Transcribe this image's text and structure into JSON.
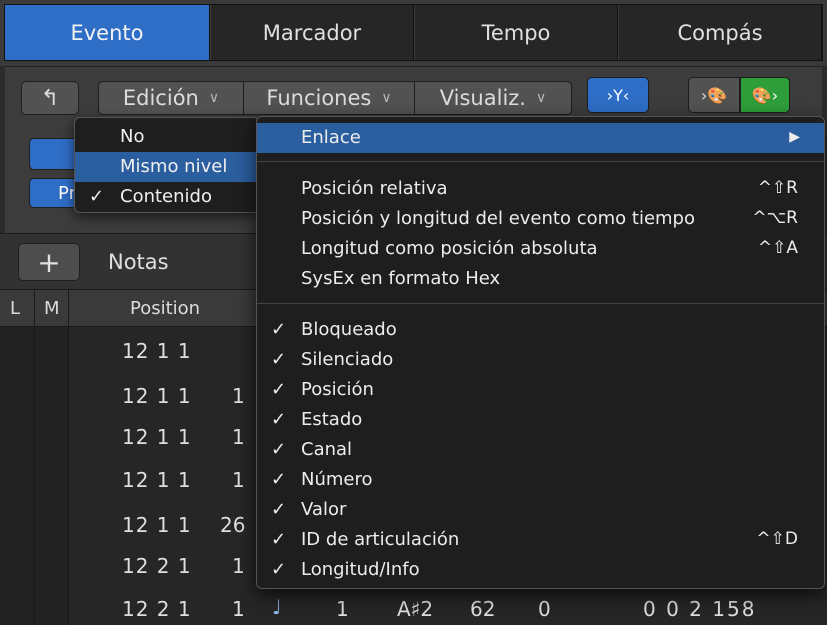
{
  "tabs": [
    "Evento",
    "Marcador",
    "Tempo",
    "Compás"
  ],
  "toolbar": {
    "back_glyph": "↰",
    "edicion": "Edición",
    "funciones": "Funciones",
    "visualiz": "Visualiz.",
    "filter_glyph": "›Y‹",
    "out_glyph": "›🎨",
    "in_glyph": "🎨›",
    "row2_b_text": "Pr"
  },
  "list": {
    "add_glyph": "+",
    "title": "Notas",
    "columns": {
      "l": "L",
      "m": "M",
      "position": "Position"
    }
  },
  "rows": [
    {
      "pos": "12 1 1",
      "frac": ""
    },
    {
      "pos": "12 1 1",
      "frac": "1"
    },
    {
      "pos": "12 1 1",
      "frac": "1"
    },
    {
      "pos": "12 1 1",
      "frac": "1"
    },
    {
      "pos": "12 1 1",
      "frac": "26"
    },
    {
      "pos": "12 2 1",
      "frac": "1"
    }
  ],
  "last_row": {
    "pos": "12 2 1",
    "frac": "1",
    "note_glyph": "♩",
    "channel": "1",
    "number": "A♯2",
    "value": "62",
    "articulation": "0",
    "length": "0 0 2 158"
  },
  "submenu": {
    "items": [
      {
        "label": "No",
        "checked": false,
        "highlighted": false
      },
      {
        "label": "Mismo nivel",
        "checked": false,
        "highlighted": true
      },
      {
        "label": "Contenido",
        "checked": true,
        "highlighted": false
      }
    ]
  },
  "mainmenu": {
    "enlace": "Enlace",
    "section1": [
      {
        "label": "Posición relativa",
        "shortcut": "^⇧R"
      },
      {
        "label": "Posición y longitud del evento como tiempo",
        "shortcut": "^⌥R"
      },
      {
        "label": "Longitud como posición absoluta",
        "shortcut": "^⇧A"
      },
      {
        "label": "SysEx en formato Hex",
        "shortcut": ""
      }
    ],
    "section2": [
      {
        "label": "Bloqueado",
        "shortcut": ""
      },
      {
        "label": "Silenciado",
        "shortcut": ""
      },
      {
        "label": "Posición",
        "shortcut": ""
      },
      {
        "label": "Estado",
        "shortcut": ""
      },
      {
        "label": "Canal",
        "shortcut": ""
      },
      {
        "label": "Número",
        "shortcut": ""
      },
      {
        "label": "Valor",
        "shortcut": ""
      },
      {
        "label": "ID de articulación",
        "shortcut": "^⇧D"
      },
      {
        "label": "Longitud/Info",
        "shortcut": ""
      }
    ],
    "check_glyph": "✓",
    "arrow_glyph": "▶"
  },
  "colors": {
    "accent": "#2f6ec7",
    "highlight": "#2b5e9f",
    "green": "#2e9e3a"
  }
}
